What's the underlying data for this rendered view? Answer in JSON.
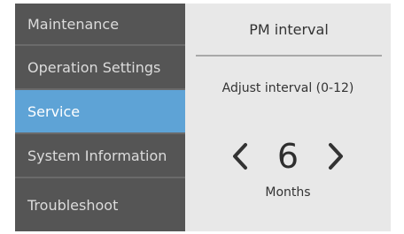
{
  "sidebar": {
    "items": [
      {
        "label": "Maintenance"
      },
      {
        "label": "Operation Settings"
      },
      {
        "label": "Service"
      },
      {
        "label": "System Information"
      },
      {
        "label": "Troubleshoot"
      }
    ],
    "selected": "Service"
  },
  "panel": {
    "title": "PM interval",
    "subtitle": "Adjust interval (0-12)",
    "value": "6",
    "unit": "Months",
    "decrease_icon": "chevron-left-icon",
    "increase_icon": "chevron-right-icon"
  },
  "colors": {
    "sidebar_bg": "#555555",
    "selected_bg": "#5ea3d6",
    "content_bg": "#e8e8e8"
  }
}
